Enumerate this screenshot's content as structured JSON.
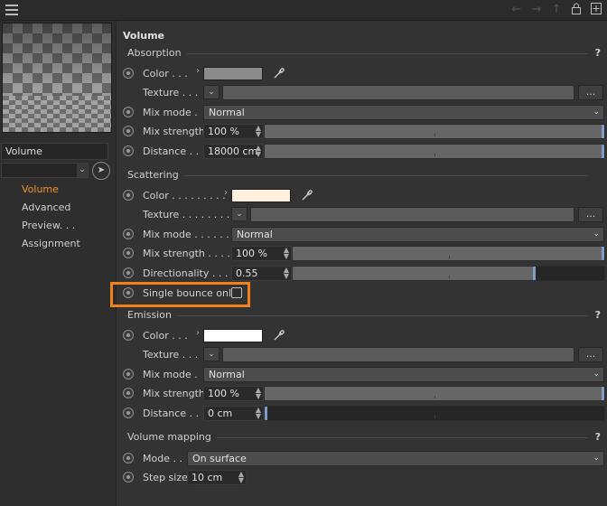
{
  "sidebar": {
    "material_name": "Volume",
    "nav": [
      "Volume",
      "Advanced",
      "Preview. . .",
      "Assignment"
    ]
  },
  "panel": {
    "title": "Volume",
    "help": "?",
    "more": "...",
    "absorption": {
      "header": "Absorption",
      "color_label": "Color . . .",
      "color": "#8c8c8c",
      "texture_label": "Texture . . .",
      "mix_mode_label": "Mix mode .",
      "mix_mode": "Normal",
      "mix_strength_label": "Mix strength",
      "mix_strength": "100 %",
      "mix_strength_fraction": 1.0,
      "distance_label": "Distance . .",
      "distance": "18000 cm",
      "distance_fraction": 1.0
    },
    "scattering": {
      "header": "Scattering",
      "color_label": "Color . . . . . . . . .",
      "color": "#fff1de",
      "texture_label": "Texture . . . . . . . .",
      "mix_mode_label": "Mix mode . . . . . .",
      "mix_mode": "Normal",
      "mix_strength_label": "Mix strength . . . .",
      "mix_strength": "100 %",
      "mix_strength_fraction": 1.0,
      "directionality_label": "Directionality . . . .",
      "directionality": "0.55",
      "directionality_fraction": 0.78,
      "single_bounce_label": "Single bounce only",
      "single_bounce_checked": false
    },
    "emission": {
      "header": "Emission",
      "color_label": "Color . . .",
      "color": "#ffffff",
      "texture_label": "Texture . . .",
      "mix_mode_label": "Mix mode .",
      "mix_mode": "Normal",
      "mix_strength_label": "Mix strength",
      "mix_strength": "100 %",
      "mix_strength_fraction": 1.0,
      "distance_label": "Distance . .",
      "distance": "0 cm",
      "distance_fraction": 0.0
    },
    "volume_mapping": {
      "header": "Volume mapping",
      "mode_label": "Mode . .",
      "mode": "On surface",
      "step_size_label": "Step size",
      "step_size": "10 cm"
    }
  },
  "colors": {
    "accent": "#f0932b",
    "highlight": "#f0821e",
    "slider_handle": "#7f9cc9"
  },
  "icons": [
    "menu-icon",
    "back-arrow-icon",
    "forward-arrow-icon",
    "up-arrow-icon",
    "lock-icon",
    "new-window-icon",
    "eyedropper-icon",
    "pick-cursor-icon"
  ]
}
